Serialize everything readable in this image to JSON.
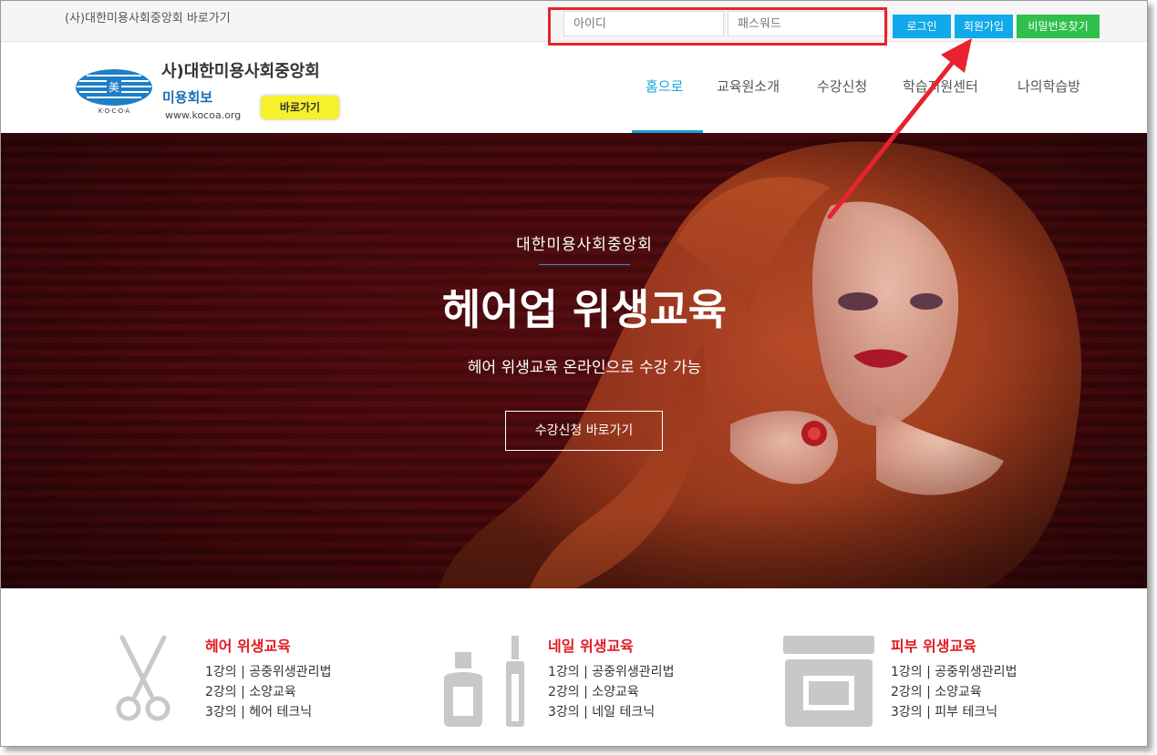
{
  "topbar": {
    "site_link": "(사)대한미용사회중앙회 바로가기",
    "id_placeholder": "아이디",
    "pw_placeholder": "패스워드",
    "login_label": "로그인",
    "join_label": "회원가입",
    "find_pw_label": "비밀번호찾기"
  },
  "header": {
    "logo_title": "사)대한미용사회중앙회",
    "logo_sub": "미용회보",
    "logo_url": "www.kocoa.org",
    "logo_button": "바로가기",
    "logo_emblem_text": "K·O·C·O·A",
    "nav": [
      "홈으로",
      "교육원소개",
      "수강신청",
      "학습지원센터",
      "나의학습방"
    ],
    "active_nav": "홈으로"
  },
  "hero": {
    "kicker": "대한미용사회중앙회",
    "title": "헤어업 위생교육",
    "description": "헤어 위생교육 온라인으로 수강 가능",
    "cta": "수강신청 바로가기"
  },
  "services": [
    {
      "title": "헤어 위생교육",
      "icon": "scissors-icon",
      "lines": [
        "1강의 | 공중위생관리법",
        "2강의 | 소양교육",
        "3강의 | 헤어 테크닉"
      ]
    },
    {
      "title": "네일 위생교육",
      "icon": "nail-polish-icon",
      "lines": [
        "1강의 | 공중위생관리법",
        "2강의 | 소양교육",
        "3강의 | 네일 테크닉"
      ]
    },
    {
      "title": "피부 위생교육",
      "icon": "cream-jar-icon",
      "lines": [
        "1강의 | 공중위생관리법",
        "2강의 | 소양교육",
        "3강의 | 피부 테크닉"
      ]
    }
  ],
  "colors": {
    "accent_blue": "#12a9ea",
    "accent_green": "#2ec04a",
    "highlight_red": "#e8222e",
    "service_title_red": "#e21a22",
    "hero_bg": "#4a0a0e"
  }
}
